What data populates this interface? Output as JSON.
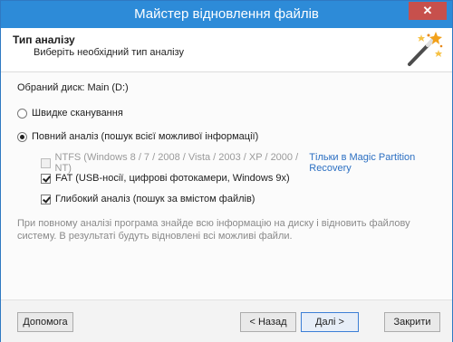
{
  "window": {
    "title": "Майстер відновлення файлів",
    "close_glyph": "✕"
  },
  "header": {
    "title": "Тип аналізу",
    "subtitle": "Виберіть необхідний тип аналізу",
    "icon": "magic-wand-icon"
  },
  "content": {
    "selected_disk": "Обраний диск: Main (D:)",
    "quick_scan_label": "Швидке сканування",
    "full_analysis_label": "Повний аналіз (пошук всієї можливої інформації)",
    "ntfs_label": "NTFS (Windows 8 / 7 / 2008 / Vista / 2003 / XP / 2000 / NT)",
    "ntfs_link": "Тільки в Magic Partition Recovery",
    "fat_label": "FAT (USB-носії, цифрові фотокамери, Windows 9x)",
    "deep_label": "Глибокий аналіз (пошук за вмістом файлів)",
    "info_text": "При повному аналізі програма знайде всю інформацію на диску і відновить файлову систему. В результаті будуть відновлені всі можливі файли."
  },
  "state": {
    "quick_scan_selected": false,
    "full_analysis_selected": true,
    "ntfs_checked": false,
    "ntfs_disabled": true,
    "fat_checked": true,
    "deep_checked": true
  },
  "buttons": {
    "help": "Допомога",
    "back": "< Назад",
    "next": "Далі >",
    "cancel": "Закрити"
  },
  "colors": {
    "titlebar": "#2d8bd8",
    "link": "#2b6fc2",
    "close": "#c7504c"
  }
}
